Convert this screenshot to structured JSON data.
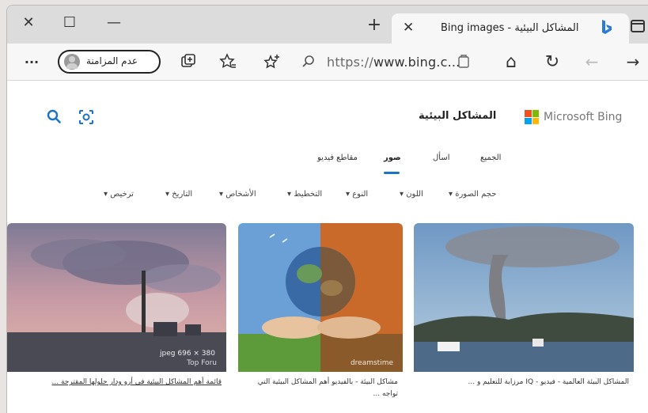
{
  "window": {
    "close_glyph": "✕",
    "restore_glyph": "☐",
    "minimize_glyph": "—",
    "new_tab_glyph": "+"
  },
  "tab": {
    "title": "المشاكل البيئية - Bing images",
    "close_glyph": "✕"
  },
  "toolbar": {
    "more_glyph": "···",
    "profile_name": "عدم المزامنة",
    "url": "https://www.bing.c...",
    "url_prefix": "https://",
    "url_host": "www.bing.c...",
    "back_glyph": "→",
    "forward_glyph": "←",
    "refresh_glyph": "↻",
    "home_glyph": "⌂"
  },
  "page": {
    "brand": "Microsoft Bing",
    "query": "المشاكل البيئية",
    "nav": {
      "all": "الجميع",
      "copilot": "اسأل",
      "images": "صور",
      "videos": "مقاطع فيديو"
    },
    "filters": [
      "حجم الصورة",
      "اللون",
      "النوع",
      "التخطيط",
      "الأشخاص",
      "التاريخ",
      "ترخيص"
    ],
    "results": [
      {
        "caption": "قائمة أهم المشاكل البيئية في أرو ودار حلولها المقترحة ...",
        "size_label": "jpeg 696 × 380",
        "source_label": "Top Foru"
      },
      {
        "caption": "مشاكل البيئة - بالفيديو أهم المشاكل البيئية التي تواجه ...",
        "source_label": "dreamstime"
      },
      {
        "caption": "المشاكل البيئة العالمية - فيديو - IQ مرزابة للتعليم و ..."
      }
    ]
  },
  "colors": {
    "accent": "#1a73c7",
    "bing_blue": "#2b7bd6"
  }
}
